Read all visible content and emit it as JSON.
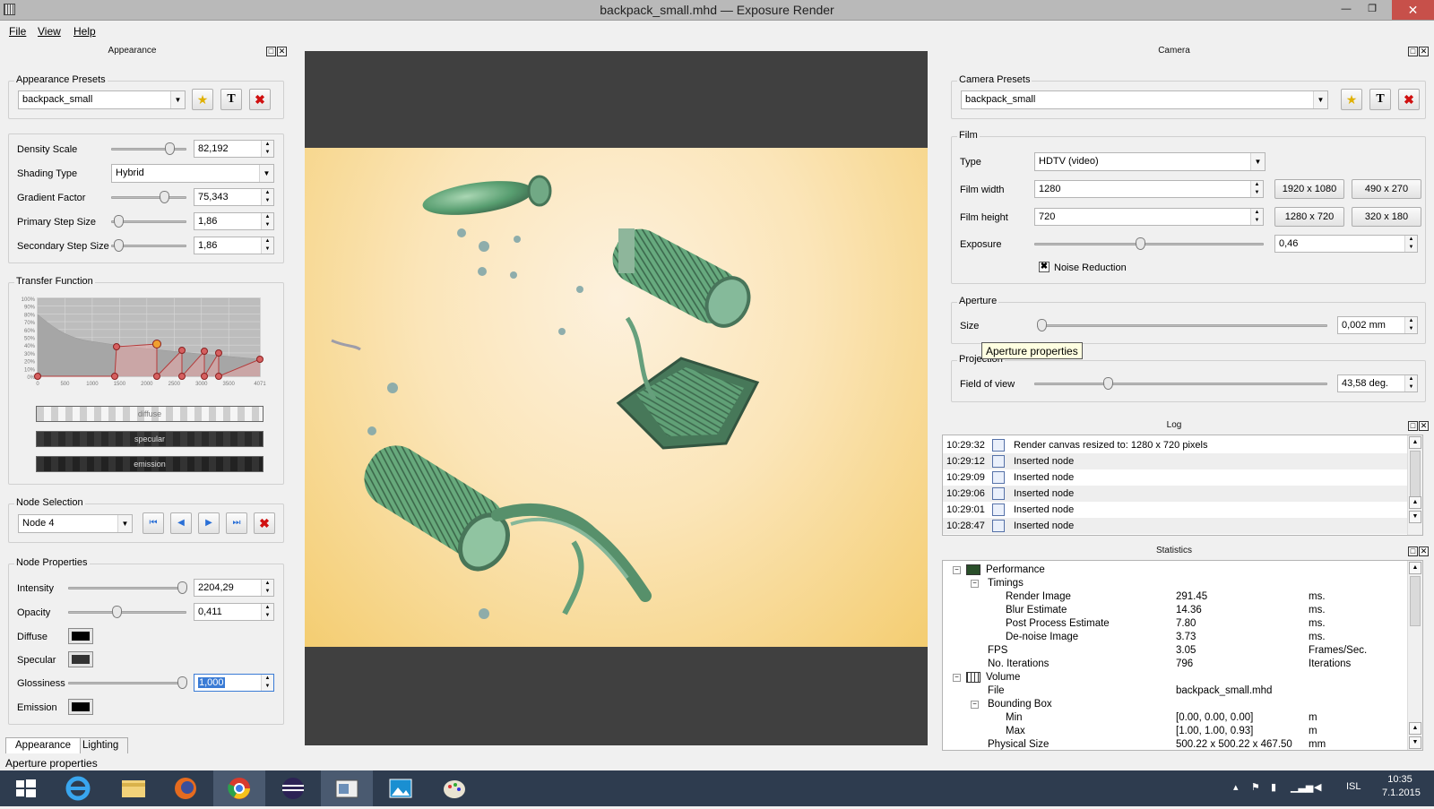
{
  "window": {
    "title": "backpack_small.mhd — Exposure Render"
  },
  "menu": [
    "File",
    "View",
    "Help"
  ],
  "left_dock": {
    "title": "Appearance",
    "appearance_presets": {
      "title": "Appearance Presets",
      "selected": "backpack_small"
    },
    "params": [
      {
        "label": "Density Scale",
        "value": "82,192",
        "level": 0.77
      },
      {
        "label": "Shading Type",
        "value": "Hybrid"
      },
      {
        "label": "Gradient Factor",
        "value": "75,343",
        "level": 0.7
      },
      {
        "label": "Primary Step Size",
        "value": "1,86",
        "level": 0.1
      },
      {
        "label": "Secondary Step Size",
        "value": "1,86",
        "level": 0.1
      }
    ],
    "transfer_function": {
      "title": "Transfer Function",
      "y_ticks": [
        "100%",
        "90%",
        "80%",
        "70%",
        "60%",
        "50%",
        "40%",
        "30%",
        "20%",
        "10%",
        "0%"
      ],
      "x_ticks": [
        "0",
        "500",
        "1000",
        "1500",
        "2000",
        "2500",
        "3000",
        "3500",
        "4071"
      ],
      "bars": [
        "diffuse",
        "specular",
        "emission"
      ]
    },
    "node_selection": {
      "title": "Node Selection",
      "selected": "Node 4"
    },
    "node_properties": {
      "title": "Node Properties",
      "intensity": {
        "label": "Intensity",
        "value": "2204,29",
        "level": 0.96
      },
      "opacity": {
        "label": "Opacity",
        "value": "0,411",
        "level": 0.41
      },
      "diffuse": {
        "label": "Diffuse",
        "color": "#000000"
      },
      "specular": {
        "label": "Specular",
        "color": "#333333"
      },
      "glossiness": {
        "label": "Glossiness",
        "value": "1,000",
        "level": 0.96
      },
      "emission": {
        "label": "Emission",
        "color": "#000000"
      }
    },
    "tabs": [
      "Appearance",
      "Lighting"
    ]
  },
  "right_dock": {
    "title": "Camera",
    "camera_presets": {
      "title": "Camera Presets",
      "selected": "backpack_small"
    },
    "film": {
      "title": "Film",
      "type_label": "Type",
      "type_value": "HDTV (video)",
      "width_label": "Film width",
      "width_value": "1280",
      "height_label": "Film height",
      "height_value": "720",
      "exposure_label": "Exposure",
      "exposure_value": "0,46",
      "exposure_level": 0.46,
      "presets": [
        "1920 x 1080",
        "490 x 270",
        "1280 x 720",
        "320 x 180"
      ],
      "noise_reduction_label": "Noise Reduction",
      "noise_reduction_checked": true
    },
    "aperture": {
      "title": "Aperture",
      "size_label": "Size",
      "size_value": "0,002 mm",
      "level": 0.01,
      "tooltip": "Aperture properties"
    },
    "projection": {
      "title": "Projection",
      "fov_label": "Field of view",
      "fov_value": "43,58 deg.",
      "level": 0.25
    }
  },
  "log": {
    "title": "Log",
    "rows": [
      {
        "time": "10:29:32",
        "message": "Render canvas resized to: 1280 x 720 pixels"
      },
      {
        "time": "10:29:12",
        "message": "Inserted node"
      },
      {
        "time": "10:29:09",
        "message": "Inserted node"
      },
      {
        "time": "10:29:06",
        "message": "Inserted node"
      },
      {
        "time": "10:29:01",
        "message": "Inserted node"
      },
      {
        "time": "10:28:47",
        "message": "Inserted node"
      }
    ]
  },
  "statistics": {
    "title": "Statistics",
    "rows": [
      {
        "depth": 0,
        "exp": "−",
        "icon": "chart",
        "name": "Performance",
        "value": "",
        "unit": ""
      },
      {
        "depth": 1,
        "exp": "−",
        "name": "Timings",
        "value": "",
        "unit": ""
      },
      {
        "depth": 2,
        "name": "Render Image",
        "value": "291.45",
        "unit": "ms."
      },
      {
        "depth": 2,
        "name": "Blur Estimate",
        "value": "14.36",
        "unit": "ms."
      },
      {
        "depth": 2,
        "name": "Post Process Estimate",
        "value": "7.80",
        "unit": "ms."
      },
      {
        "depth": 2,
        "name": "De-noise Image",
        "value": "3.73",
        "unit": "ms."
      },
      {
        "depth": 1,
        "name": "FPS",
        "value": "3.05",
        "unit": "Frames/Sec."
      },
      {
        "depth": 1,
        "name": "No. Iterations",
        "value": "796",
        "unit": "Iterations"
      },
      {
        "depth": 0,
        "exp": "−",
        "icon": "grid",
        "name": "Volume",
        "value": "",
        "unit": ""
      },
      {
        "depth": 1,
        "name": "File",
        "value": "backpack_small.mhd",
        "unit": ""
      },
      {
        "depth": 1,
        "exp": "−",
        "name": "Bounding Box",
        "value": "",
        "unit": ""
      },
      {
        "depth": 2,
        "name": "Min",
        "value": "[0.00, 0.00, 0.00]",
        "unit": "m"
      },
      {
        "depth": 2,
        "name": "Max",
        "value": "[1.00, 1.00, 0.93]",
        "unit": "m"
      },
      {
        "depth": 1,
        "name": "Physical Size",
        "value": "500.22 x 500.22 x 467.50",
        "unit": "mm"
      }
    ]
  },
  "status_bar": "Aperture properties",
  "taskbar": {
    "lang": "ISL",
    "time": "10:35",
    "date": "7.1.2015"
  },
  "colors": {
    "titlebar": "#b9b9b9",
    "close": "#c7504a",
    "taskbar": "#2e3c4f",
    "viewport": "#404040"
  }
}
